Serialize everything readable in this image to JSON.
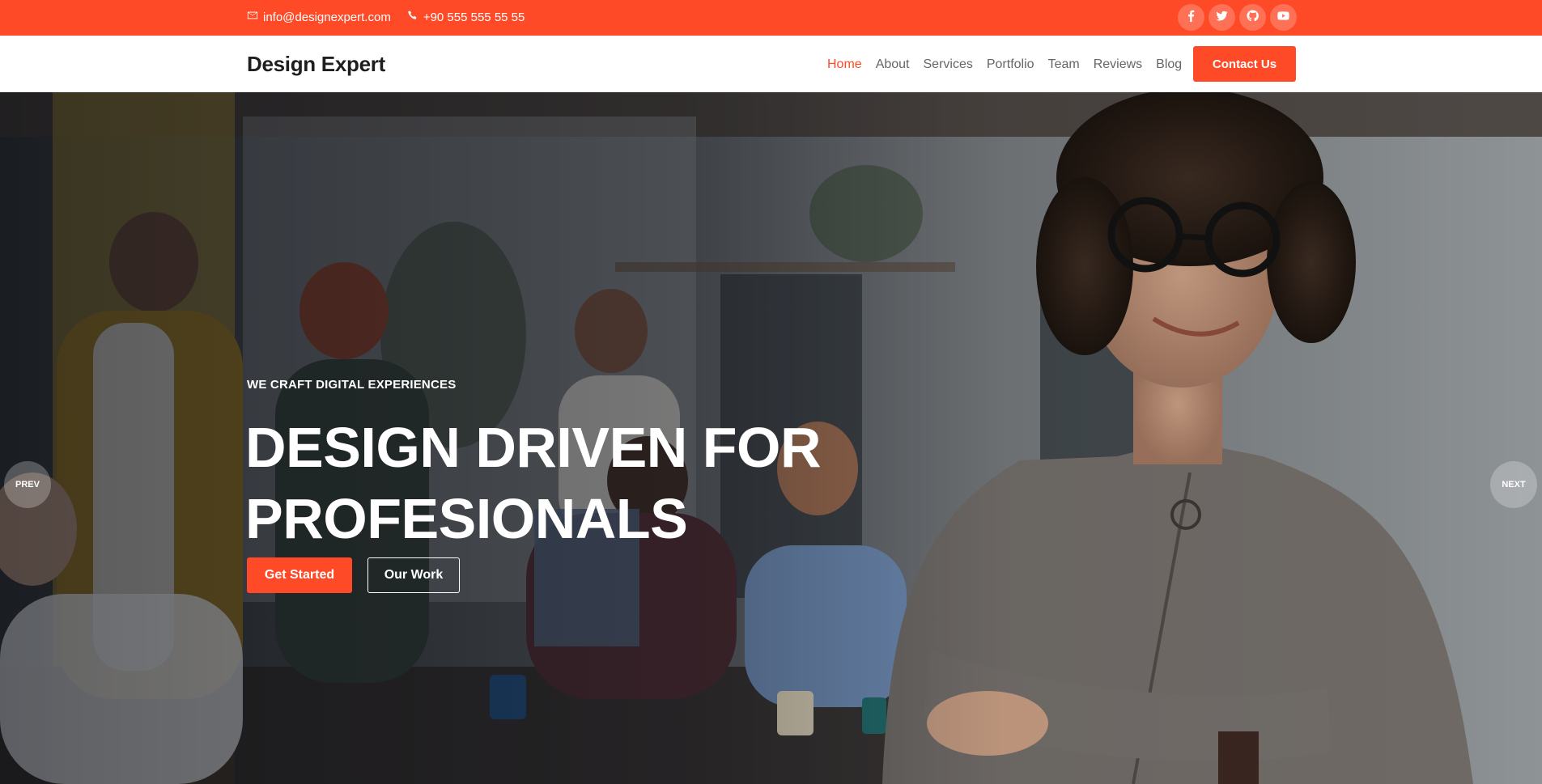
{
  "topbar": {
    "email": "info@designexpert.com",
    "phone": "+90 555 555 55 55",
    "social": [
      "facebook-icon",
      "twitter-icon",
      "github-icon",
      "youtube-icon"
    ],
    "background": "#ff4a27"
  },
  "header": {
    "logo": "Design Expert",
    "nav": {
      "home": "Home",
      "about": "About",
      "services": "Services",
      "portfolio": "Portfolio",
      "team": "Team",
      "reviews": "Reviews",
      "blog": "Blog"
    },
    "active_nav": "Home",
    "cta": "Contact Us"
  },
  "hero": {
    "kicker": "WE CRAFT DIGITAL EXPERIENCES",
    "headline_line1": "DESIGN DRIVEN FOR",
    "headline_line2": "PROFESIONALS",
    "primary_button": "Get Started",
    "secondary_button": "Our Work",
    "prev_label": "PREV",
    "next_label": "NEXT"
  },
  "colors": {
    "accent": "#ff4a27",
    "text_dark": "#1e1e1e",
    "nav_text": "#666666"
  }
}
